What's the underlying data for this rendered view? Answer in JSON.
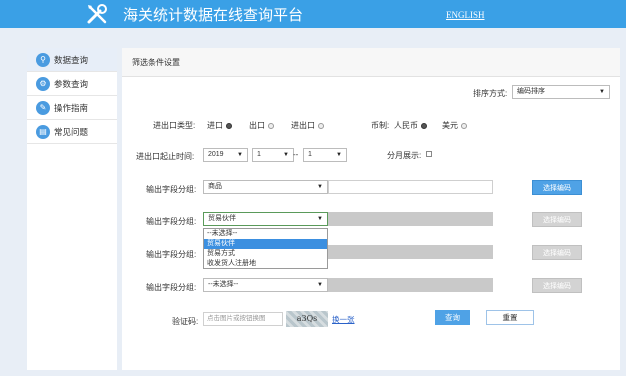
{
  "header": {
    "title": "海关统计数据在线查询平台",
    "lang_link": "ENGLISH"
  },
  "sidebar": {
    "items": [
      {
        "label": "数据查询",
        "icon": "search-icon"
      },
      {
        "label": "参数查询",
        "icon": "gear-icon"
      },
      {
        "label": "操作指南",
        "icon": "book-icon"
      },
      {
        "label": "常见问题",
        "icon": "question-icon"
      }
    ]
  },
  "panel": {
    "title": "筛选条件设置"
  },
  "sort": {
    "label": "排序方式:",
    "value": "编码排序"
  },
  "trade_type": {
    "label": "进出口类型:",
    "options": [
      "进口",
      "出口",
      "进出口"
    ]
  },
  "currency": {
    "label": "币制:",
    "options": [
      "人民币",
      "美元"
    ]
  },
  "period": {
    "label": "进出口起止时间:",
    "year": "2019",
    "month_start": "1",
    "separator": "--",
    "month_end": "1"
  },
  "monthly": {
    "label": "分月展示:"
  },
  "groups": [
    {
      "label": "输出字段分组:",
      "value": "商品",
      "button": "选择编码"
    },
    {
      "label": "输出字段分组:",
      "value": "贸易伙伴",
      "button": "选择编码"
    },
    {
      "label": "输出字段分组:",
      "value": "",
      "button": "选择编码"
    },
    {
      "label": "输出字段分组:",
      "value": "--未选择--",
      "button": "选择编码"
    }
  ],
  "dropdown": {
    "options": [
      "--未选择--",
      "贸易伙伴",
      "贸易方式",
      "收发货人注册地"
    ]
  },
  "captcha": {
    "label": "验证码:",
    "placeholder": "点击图片或按钮换图",
    "image_text": "a3Qs",
    "refresh": "换一张"
  },
  "actions": {
    "query": "查询",
    "reset": "重置"
  }
}
